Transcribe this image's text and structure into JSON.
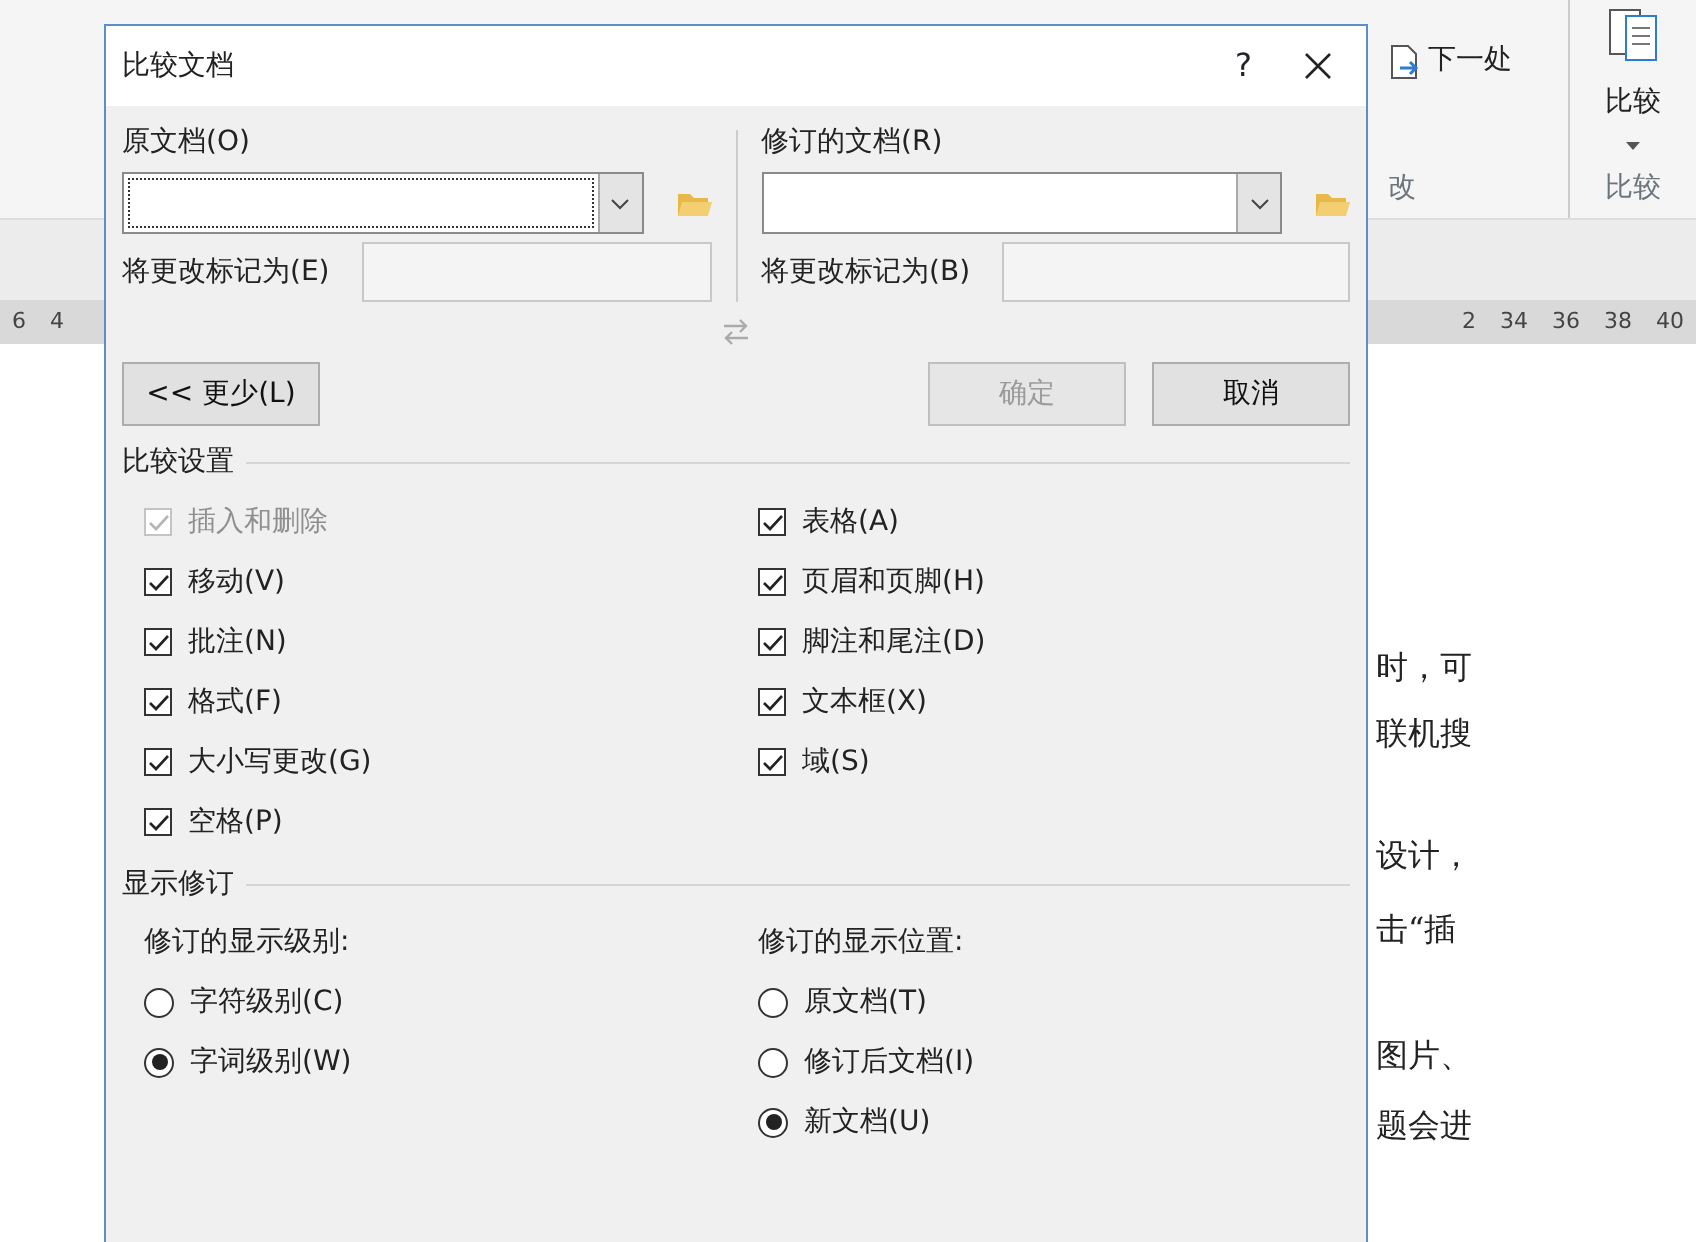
{
  "background": {
    "ribbon": {
      "next_change": "下一处",
      "compare_button": "比较",
      "group_label_changes": "改",
      "group_label_compare": "比较"
    },
    "ruler": {
      "left_marks": [
        "6",
        "4"
      ],
      "right_marks": [
        "2",
        "34",
        "36",
        "38",
        "40"
      ]
    },
    "document_lines": [
      "时，可",
      "联机搜",
      "设计，",
      "击“插",
      "图片、",
      "题会进"
    ]
  },
  "dialog": {
    "title": "比较文档",
    "help": "?",
    "original": {
      "label": "原文档(O)",
      "label_changes_as": "将更改标记为(E)",
      "focused": true
    },
    "revised": {
      "label": "修订的文档(R)",
      "label_changes_as": "将更改标记为(B)",
      "focused": false
    },
    "buttons": [
      {
        "label": "<< 更少(L)",
        "disabled": false
      },
      {
        "label": "确定",
        "disabled": true
      },
      {
        "label": "取消",
        "disabled": false
      }
    ],
    "comparison_settings": {
      "title": "比较设置",
      "left": [
        {
          "label": "插入和删除",
          "checked": true,
          "disabled": true
        },
        {
          "label": "移动(V)",
          "checked": true,
          "disabled": false
        },
        {
          "label": "批注(N)",
          "checked": true,
          "disabled": false
        },
        {
          "label": "格式(F)",
          "checked": true,
          "disabled": false
        },
        {
          "label": "大小写更改(G)",
          "checked": true,
          "disabled": false
        },
        {
          "label": "空格(P)",
          "checked": true,
          "disabled": false
        }
      ],
      "right": [
        {
          "label": "表格(A)",
          "checked": true,
          "disabled": false
        },
        {
          "label": "页眉和页脚(H)",
          "checked": true,
          "disabled": false
        },
        {
          "label": "脚注和尾注(D)",
          "checked": true,
          "disabled": false
        },
        {
          "label": "文本框(X)",
          "checked": true,
          "disabled": false
        },
        {
          "label": "域(S)",
          "checked": true,
          "disabled": false
        }
      ]
    },
    "show_changes": {
      "title": "显示修订",
      "level": {
        "label": "修订的显示级别:",
        "options": [
          {
            "label": "字符级别(C)",
            "selected": false
          },
          {
            "label": "字词级别(W)",
            "selected": true
          }
        ]
      },
      "location": {
        "label": "修订的显示位置:",
        "options": [
          {
            "label": "原文档(T)",
            "selected": false
          },
          {
            "label": "修订后文档(I)",
            "selected": false
          },
          {
            "label": "新文档(U)",
            "selected": true
          }
        ]
      }
    }
  }
}
